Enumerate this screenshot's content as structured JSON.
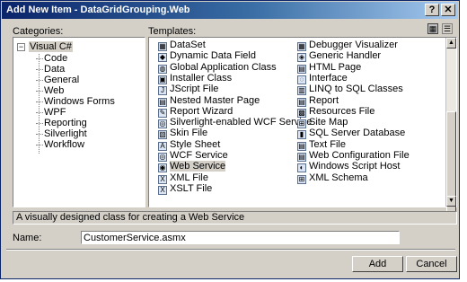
{
  "window": {
    "title": "Add New Item - DataGridGrouping.Web",
    "help_label": "?",
    "close_label": "✕"
  },
  "categories": {
    "label": "Categories:",
    "root": {
      "label": "Visual C#",
      "expander": "−"
    },
    "items": [
      "Code",
      "Data",
      "General",
      "Web",
      "Windows Forms",
      "WPF",
      "Reporting",
      "Silverlight",
      "Workflow"
    ]
  },
  "templates": {
    "label": "Templates:",
    "column1": [
      {
        "label": "DataSet",
        "icon": "dataset-icon",
        "glyph": "▦"
      },
      {
        "label": "Dynamic Data Field",
        "icon": "dynamic-data-icon",
        "glyph": "◆"
      },
      {
        "label": "Global Application Class",
        "icon": "global-app-icon",
        "glyph": "◍"
      },
      {
        "label": "Installer Class",
        "icon": "installer-icon",
        "glyph": "▣"
      },
      {
        "label": "JScript File",
        "icon": "jscript-icon",
        "glyph": "J"
      },
      {
        "label": "Nested Master Page",
        "icon": "nested-master-icon",
        "glyph": "▤"
      },
      {
        "label": "Report Wizard",
        "icon": "report-wizard-icon",
        "glyph": "✎"
      },
      {
        "label": "Silverlight-enabled WCF Service",
        "icon": "silverlight-wcf-icon",
        "glyph": "◎"
      },
      {
        "label": "Skin File",
        "icon": "skin-file-icon",
        "glyph": "▧"
      },
      {
        "label": "Style Sheet",
        "icon": "style-sheet-icon",
        "glyph": "A"
      },
      {
        "label": "WCF Service",
        "icon": "wcf-service-icon",
        "glyph": "◎"
      },
      {
        "label": "Web Service",
        "icon": "web-service-icon",
        "glyph": "◉"
      },
      {
        "label": "XML File",
        "icon": "xml-file-icon",
        "glyph": "X"
      },
      {
        "label": "XSLT File",
        "icon": "xslt-file-icon",
        "glyph": "X"
      }
    ],
    "column2": [
      {
        "label": "Debugger Visualizer",
        "icon": "debugger-visualizer-icon",
        "glyph": "▦"
      },
      {
        "label": "Generic Handler",
        "icon": "generic-handler-icon",
        "glyph": "◈"
      },
      {
        "label": "HTML Page",
        "icon": "html-page-icon",
        "glyph": "▤"
      },
      {
        "label": "Interface",
        "icon": "interface-icon",
        "glyph": "◌"
      },
      {
        "label": "LINQ to SQL Classes",
        "icon": "linq-sql-icon",
        "glyph": "▥"
      },
      {
        "label": "Report",
        "icon": "report-icon",
        "glyph": "▤"
      },
      {
        "label": "Resources File",
        "icon": "resources-file-icon",
        "glyph": "▩"
      },
      {
        "label": "Site Map",
        "icon": "site-map-icon",
        "glyph": "⊞"
      },
      {
        "label": "SQL Server Database",
        "icon": "sql-database-icon",
        "glyph": "▮"
      },
      {
        "label": "Text File",
        "icon": "text-file-icon",
        "glyph": "▤"
      },
      {
        "label": "Web Configuration File",
        "icon": "web-config-icon",
        "glyph": "▤"
      },
      {
        "label": "Windows Script Host",
        "icon": "script-host-icon",
        "glyph": "◐"
      },
      {
        "label": "XML Schema",
        "icon": "xml-schema-icon",
        "glyph": "⊞"
      }
    ],
    "selected": "Web Service"
  },
  "description": "A visually designed class for creating a Web Service",
  "name_field": {
    "label": "Name:",
    "value": "CustomerService.asmx"
  },
  "buttons": {
    "add": "Add",
    "cancel": "Cancel"
  },
  "view_buttons": {
    "large_icons": "▦",
    "small_icons": "☰"
  }
}
